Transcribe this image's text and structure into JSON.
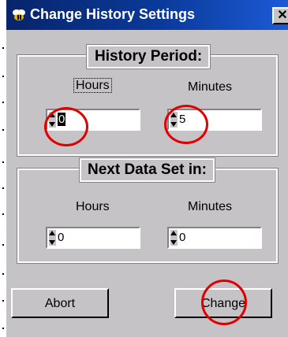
{
  "window": {
    "title": "Change History Settings",
    "close_label": "✕",
    "title_icon": "bee-icon"
  },
  "history_period": {
    "legend": "History Period:",
    "hours_label": "Hours",
    "minutes_label": "Minutes",
    "hours_value": "0",
    "minutes_value": "5"
  },
  "next_data_set": {
    "legend": "Next Data Set in:",
    "hours_label": "Hours",
    "minutes_label": "Minutes",
    "hours_value": "0",
    "minutes_value": "0"
  },
  "buttons": {
    "abort_label": "Abort",
    "change_label": "Change"
  },
  "annotation_color": "#e00000"
}
